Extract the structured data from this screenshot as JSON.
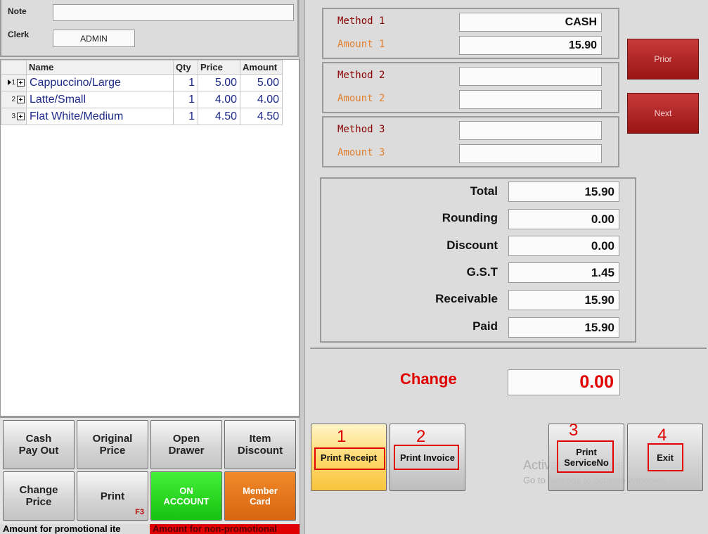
{
  "header": {
    "note_label": "Note",
    "note_value": "",
    "clerk_label": "Clerk",
    "clerk_value": "ADMIN"
  },
  "grid": {
    "columns": [
      "Name",
      "Qty",
      "Price",
      "Amount"
    ],
    "rows": [
      {
        "num": "1",
        "name": "Cappuccino/Large",
        "qty": "1",
        "price": "5.00",
        "amount": "5.00"
      },
      {
        "num": "2",
        "name": "Latte/Small",
        "qty": "1",
        "price": "4.00",
        "amount": "4.00"
      },
      {
        "num": "3",
        "name": "Flat White/Medium",
        "qty": "1",
        "price": "4.50",
        "amount": "4.50"
      }
    ]
  },
  "left_buttons": {
    "cash_payout": "Cash\nPay Out",
    "original_price": "Original\nPrice",
    "open_drawer": "Open\nDrawer",
    "item_discount": "Item\nDiscount",
    "change_price": "Change\nPrice",
    "print": "Print",
    "print_hotkey": "F3",
    "on_account": "ON\nACCOUNT",
    "member_card": "Member\nCard"
  },
  "status": {
    "promo": "Amount for promotional ite",
    "non_promo": "Amount for non-promotional"
  },
  "methods": [
    {
      "method_label": "Method 1",
      "amount_label": "Amount 1",
      "method_value": "CASH",
      "amount_value": "15.90"
    },
    {
      "method_label": "Method 2",
      "amount_label": "Amount 2",
      "method_value": "",
      "amount_value": ""
    },
    {
      "method_label": "Method 3",
      "amount_label": "Amount 3",
      "method_value": "",
      "amount_value": ""
    }
  ],
  "nav": {
    "prior": "Prior",
    "next": "Next"
  },
  "totals": [
    {
      "label": "Total",
      "value": "15.90"
    },
    {
      "label": "Rounding",
      "value": "0.00"
    },
    {
      "label": "Discount",
      "value": "0.00"
    },
    {
      "label": "G.S.T",
      "value": "1.45"
    },
    {
      "label": "Receivable",
      "value": "15.90"
    },
    {
      "label": "Paid",
      "value": "15.90"
    }
  ],
  "change": {
    "label": "Change",
    "value": "0.00"
  },
  "actions": {
    "print_receipt": "Print Receipt",
    "print_invoice": "Print Invoice",
    "print_serviceno": "Print\nServiceNo",
    "exit": "Exit",
    "callouts": [
      "1",
      "2",
      "3",
      "4"
    ]
  },
  "watermark": {
    "line1": "Activate Windows",
    "line2": "Go to Settings to activate Windows."
  },
  "colors": {
    "method_label": "#8b0000",
    "amount_label": "#e08030",
    "change": "#e00000",
    "nav_button": "#b02020",
    "on_account": "#22d31a",
    "member_card": "#e2721a",
    "print_receipt": "#ffd86b",
    "callout": "#e00000"
  }
}
